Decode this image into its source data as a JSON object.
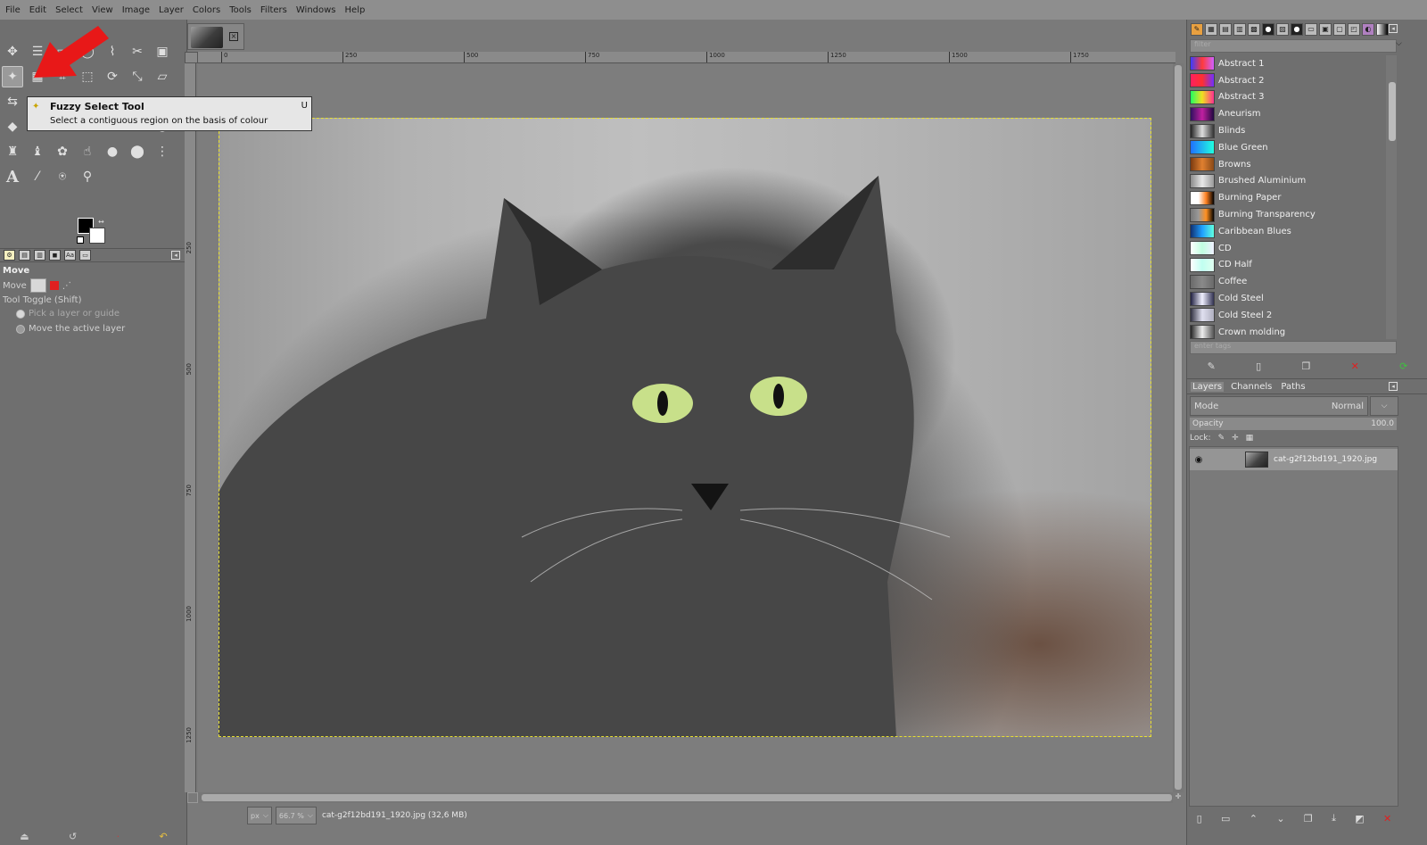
{
  "menubar": [
    "File",
    "Edit",
    "Select",
    "View",
    "Image",
    "Layer",
    "Colors",
    "Tools",
    "Filters",
    "Windows",
    "Help"
  ],
  "tooltip": {
    "title": "Fuzzy Select Tool",
    "shortcut": "U",
    "description": "Select a contiguous region on the basis of colour"
  },
  "tool_options": {
    "title": "Move",
    "move_label": "Move",
    "toggle_label": "Tool Toggle  (Shift)",
    "option1": "Pick a layer or guide",
    "option2": "Move the active layer"
  },
  "rulers": {
    "h_labels": [
      "0",
      "250",
      "500",
      "750",
      "1000",
      "1250",
      "1500",
      "1750"
    ],
    "v_labels": [
      "250",
      "500",
      "750",
      "1000",
      "1250"
    ]
  },
  "statusbar": {
    "unit": "px",
    "zoom": "66.7 %",
    "file_info": "cat-g2f12bd191_1920.jpg (32,6 MB)"
  },
  "gradients": {
    "filter_placeholder": "filter",
    "tags_placeholder": "enter tags",
    "items": [
      {
        "name": "Abstract 1",
        "colors": [
          "#3a3cff",
          "#ff3a3a",
          "#d060ff"
        ]
      },
      {
        "name": "Abstract 2",
        "colors": [
          "#ff2060",
          "#ff3030",
          "#7030ff"
        ]
      },
      {
        "name": "Abstract 3",
        "colors": [
          "#20ff60",
          "#f0e020",
          "#ff3090"
        ]
      },
      {
        "name": "Aneurism",
        "colors": [
          "#301060",
          "#c020a0",
          "#200840"
        ]
      },
      {
        "name": "Blinds",
        "colors": [
          "#222222",
          "#dddddd",
          "#333333"
        ]
      },
      {
        "name": "Blue Green",
        "colors": [
          "#2070ff",
          "#20ffe0"
        ]
      },
      {
        "name": "Browns",
        "colors": [
          "#7a3a10",
          "#e08030",
          "#8a4a18"
        ]
      },
      {
        "name": "Brushed Aluminium",
        "colors": [
          "#8a8a8a",
          "#e8e8e8",
          "#9a9a9a"
        ]
      },
      {
        "name": "Burning Paper",
        "colors": [
          "#ffffff",
          "#ffffff",
          "#ff8020",
          "#000000"
        ]
      },
      {
        "name": "Burning Transparency",
        "colors": [
          "#777777",
          "#999999",
          "#ff9020",
          "#000000"
        ]
      },
      {
        "name": "Caribbean Blues",
        "colors": [
          "#103070",
          "#20a0ff",
          "#60ffe0"
        ]
      },
      {
        "name": "CD",
        "colors": [
          "#ffffff",
          "#c0ffe0",
          "#f0f0ff"
        ]
      },
      {
        "name": "CD Half",
        "colors": [
          "#ffffff",
          "#c0fff0",
          "#e0fff0"
        ]
      },
      {
        "name": "Coffee",
        "colors": [
          "#6a6a6a",
          "#8a8a8a",
          "#6a6a6a"
        ]
      },
      {
        "name": "Cold Steel",
        "colors": [
          "#202040",
          "#f0f0ff",
          "#303050"
        ]
      },
      {
        "name": "Cold Steel 2",
        "colors": [
          "#303040",
          "#e0e0f0",
          "#b0b0c0"
        ]
      },
      {
        "name": "Crown molding",
        "colors": [
          "#222222",
          "#eeeeee",
          "#555555"
        ]
      }
    ]
  },
  "layers_panel": {
    "tabs": [
      "Layers",
      "Channels",
      "Paths"
    ],
    "mode_label": "Mode",
    "mode_value": "Normal",
    "opacity_label": "Opacity",
    "opacity_value": "100.0",
    "lock_label": "Lock:",
    "layer_name": "cat-g2f12bd191_1920.jpg"
  },
  "colors": {
    "arrow": "#e81818",
    "selection_border": "#e8e030"
  }
}
